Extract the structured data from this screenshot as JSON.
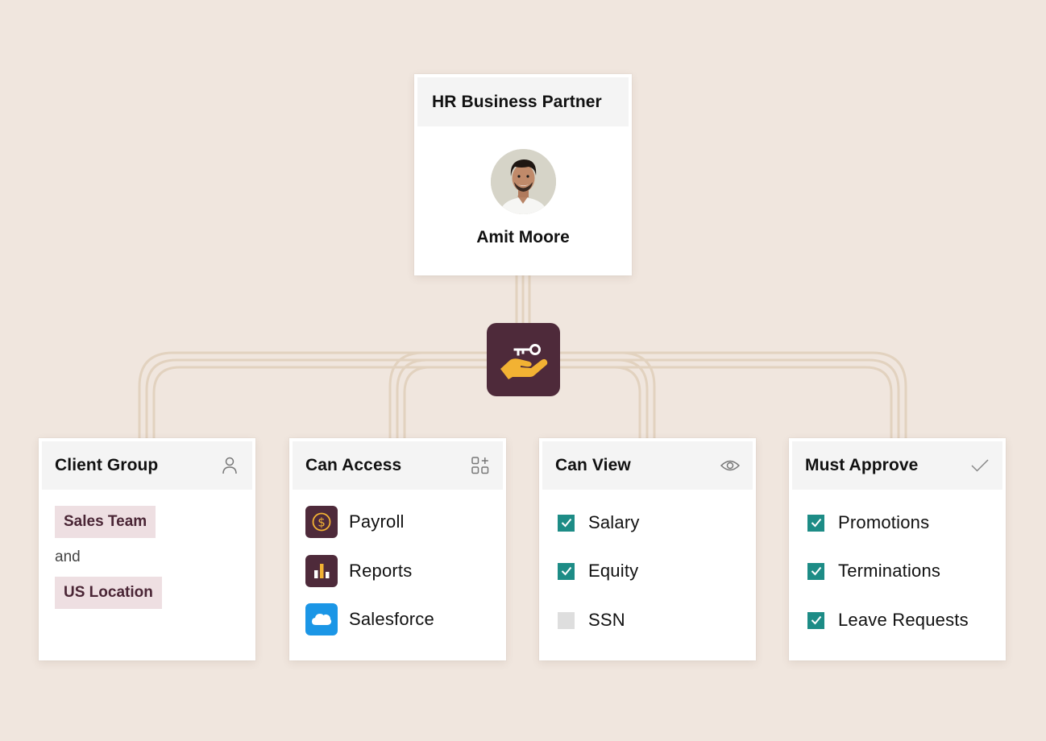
{
  "colors": {
    "background": "#f0e6de",
    "connector": "#e2d2bf",
    "badge": "#4e2a3a",
    "badge_icon": "#f2b233",
    "chip_bg": "#eedfe2",
    "checkbox": "#1d8c86",
    "salesforce": "#1b96e6"
  },
  "partner": {
    "title": "HR Business Partner",
    "name": "Amit Moore",
    "badge_icon": "hand-key-icon"
  },
  "client_group": {
    "title": "Client Group",
    "icon": "person-icon",
    "chips": [
      "Sales Team",
      "US Location"
    ],
    "joiner": "and"
  },
  "can_access": {
    "title": "Can Access",
    "icon": "add-apps-icon",
    "items": [
      {
        "label": "Payroll",
        "icon": "payroll-icon"
      },
      {
        "label": "Reports",
        "icon": "reports-icon"
      },
      {
        "label": "Salesforce",
        "icon": "salesforce-icon"
      }
    ]
  },
  "can_view": {
    "title": "Can View",
    "icon": "eye-icon",
    "items": [
      {
        "label": "Salary",
        "checked": true
      },
      {
        "label": "Equity",
        "checked": true
      },
      {
        "label": "SSN",
        "checked": false
      }
    ]
  },
  "must_approve": {
    "title": "Must Approve",
    "icon": "checkmark-icon",
    "items": [
      {
        "label": "Promotions",
        "checked": true
      },
      {
        "label": "Terminations",
        "checked": true
      },
      {
        "label": "Leave Requests",
        "checked": true
      }
    ]
  }
}
